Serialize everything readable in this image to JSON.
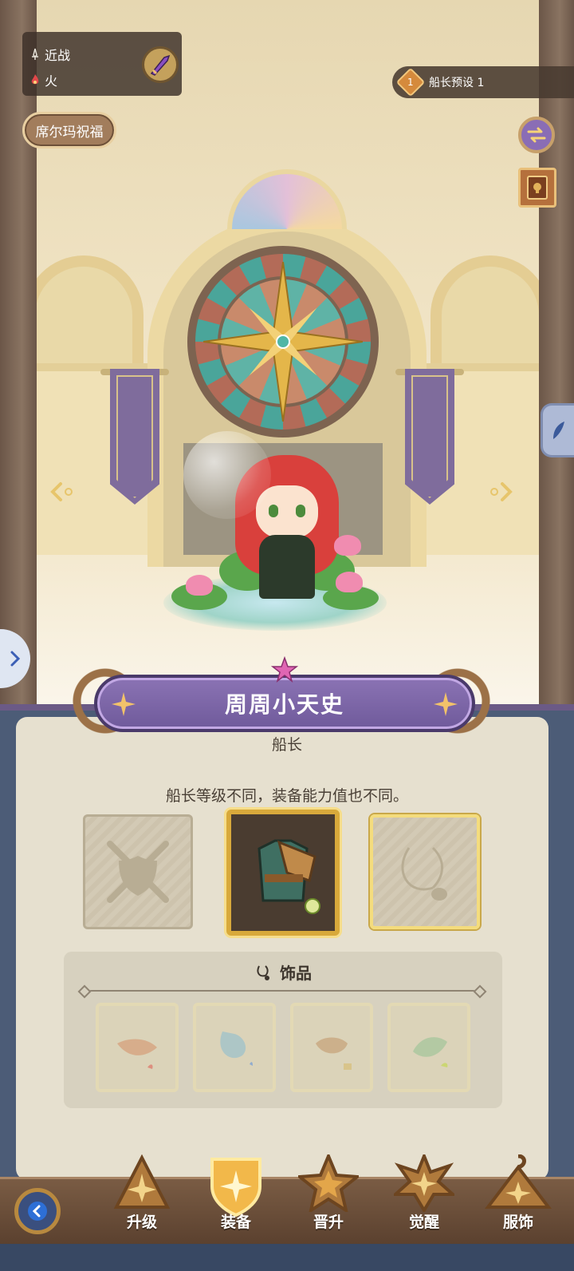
{
  "hud": {
    "attack_type": "近战",
    "element": "火",
    "blessing_button": "席尔玛祝福",
    "preset_number": "1",
    "preset_label": "船长预设 1"
  },
  "character": {
    "name": "周周小天史",
    "role": "船长"
  },
  "equipment": {
    "hint": "船长等级不同，装备能力值也不同。",
    "slots": [
      {
        "name": "weapon",
        "state": "empty"
      },
      {
        "name": "armor",
        "state": "equipped",
        "icon": "armor-icon"
      },
      {
        "name": "accessory",
        "state": "empty-selected"
      }
    ]
  },
  "accessories": {
    "title": "饰品",
    "items": [
      {
        "icon": "fire-gem-accessory-icon",
        "element_icon": "fire-element-icon"
      },
      {
        "icon": "water-amulet-accessory-icon",
        "element_icon": "water-element-icon"
      },
      {
        "icon": "earth-amulet-accessory-icon",
        "element_icon": "earth-element-icon"
      },
      {
        "icon": "wind-amulet-accessory-icon",
        "element_icon": "wind-element-icon"
      }
    ]
  },
  "nav": {
    "items": [
      {
        "label": "升级"
      },
      {
        "label": "装备"
      },
      {
        "label": "晋升"
      },
      {
        "label": "觉醒"
      },
      {
        "label": "服饰"
      }
    ],
    "active": "装备"
  },
  "colors": {
    "nameplate": "#7d66a8",
    "panel": "#e6e0cf",
    "selected_gold": "#d8a93b",
    "nav_bar": "#6a4e39"
  }
}
